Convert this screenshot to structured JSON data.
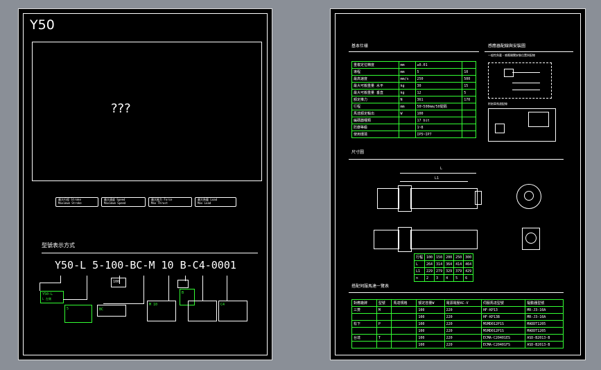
{
  "left": {
    "title": "Y50",
    "image_placeholder": "???",
    "badges": [
      {
        "top": "最大行程 Stroke",
        "bottom": "Maximum Stroke"
      },
      {
        "top": "最大速度 Speed",
        "bottom": "Maximum Speed"
      },
      {
        "top": "最大推力 Force",
        "bottom": "Max Thrust"
      },
      {
        "top": "最大負載 Load",
        "bottom": "Max Load"
      }
    ],
    "ordering_heading": "型號表示方式",
    "model_code": "Y50-L 5-100-BC-M 10 B-C4-0001",
    "code_labels": {
      "series": "Y50-L",
      "motor_side": "L 左側",
      "lead": "5",
      "stroke": "100",
      "limit": "BC",
      "motor": "M 10",
      "brake": "B",
      "cable": "C4"
    }
  },
  "right": {
    "spec_heading": "基本仕樣",
    "wiring_heading": "感應器配線與安裝圖",
    "wiring_note": "一般性負載・感應開關安裝位置與配線",
    "wiring_note2": "附剎車馬達配線",
    "dimension_heading": "尺寸圖",
    "dim_L": "L",
    "dim_L1": "L1",
    "motor_heading": "搭配伺服馬達一覽表",
    "spec_rows": [
      [
        "重複定位精度",
        "mm",
        "±0.01",
        ""
      ],
      [
        "導程",
        "mm",
        "5",
        "10"
      ],
      [
        "最高速度",
        "mm/s",
        "250",
        "500"
      ],
      [
        "最大可搬重量 水平",
        "kg",
        "30",
        "15"
      ],
      [
        "最大可搬重量 垂直",
        "kg",
        "12",
        "5"
      ],
      [
        "額定推力",
        "N",
        "361",
        "170"
      ],
      [
        "行程",
        "mm",
        "50~500mm/50間隔",
        ""
      ],
      [
        "馬達額定輸出",
        "W",
        "100",
        ""
      ],
      [
        "編碼器種類",
        "",
        "17 bit",
        ""
      ],
      [
        "防塵等級",
        "",
        "1~8",
        ""
      ],
      [
        "使用環境",
        "",
        "IP5~IP7",
        ""
      ]
    ],
    "stroke_table": {
      "headers": [
        "行程",
        "100",
        "150",
        "200",
        "250",
        "300"
      ],
      "rows": [
        [
          "L",
          "264",
          "314",
          "364",
          "414",
          "464"
        ],
        [
          "L1",
          "229",
          "279",
          "329",
          "379",
          "429"
        ],
        [
          "n",
          "2",
          "3",
          "4",
          "5",
          "6"
        ]
      ]
    },
    "motor_headers": [
      "對應廠牌",
      "型號",
      "馬達規格",
      "額定容量W",
      "電源電壓AC-V",
      "伺服馬達型號",
      "驅動器型號"
    ],
    "motor_rows": [
      [
        "三菱",
        "M",
        "",
        "100",
        "220",
        "HF-KP13",
        "MR-J3-10A"
      ],
      [
        "",
        "",
        "",
        "100",
        "220",
        "HF-KP13B",
        "MR-J3-10A"
      ],
      [
        "松下",
        "P",
        "",
        "100",
        "220",
        "MSMD012P1S",
        "MADDT1205"
      ],
      [
        "",
        "",
        "",
        "100",
        "220",
        "MSMD012P1S",
        "MADDT1205"
      ],
      [
        "台達",
        "T",
        "",
        "100",
        "220",
        "ECMA-C20401ES",
        "ASD-B2013-B"
      ],
      [
        "",
        "",
        "",
        "100",
        "220",
        "ECMA-C20401FS",
        "ASD-B2013-B"
      ]
    ]
  }
}
